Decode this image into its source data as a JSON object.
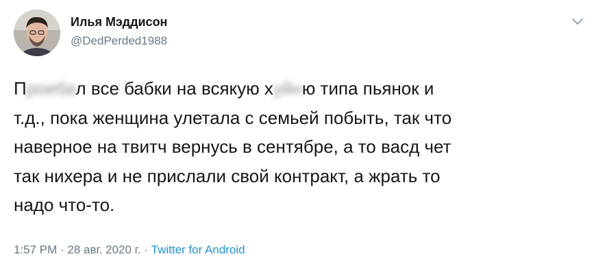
{
  "author": {
    "display_name": "Илья Мэддисон",
    "handle": "@DedPerded1988"
  },
  "tweet": {
    "line1_a": "П",
    "line1_blur1": "роеба",
    "line1_b": "л все бабки на всякую х",
    "line1_blur2": "уйн",
    "line1_c": "ю типа пьянок и",
    "line2": "т.д., пока женщина улетала с семьей побыть, так что",
    "line3": "наверное на твитч вернусь в сентябре, а то васд чет",
    "line4": "так нихера и не прислали свой контракт, а жрать то",
    "line5": "надо что-то."
  },
  "meta": {
    "time": "1:57 PM",
    "separator": " · ",
    "date": "28 авг. 2020 г.",
    "source": "Twitter for Android"
  },
  "icons": {
    "menu": "chevron-down-icon"
  },
  "colors": {
    "text": "#14171a",
    "secondary": "#657786",
    "link": "#1b95e0"
  }
}
